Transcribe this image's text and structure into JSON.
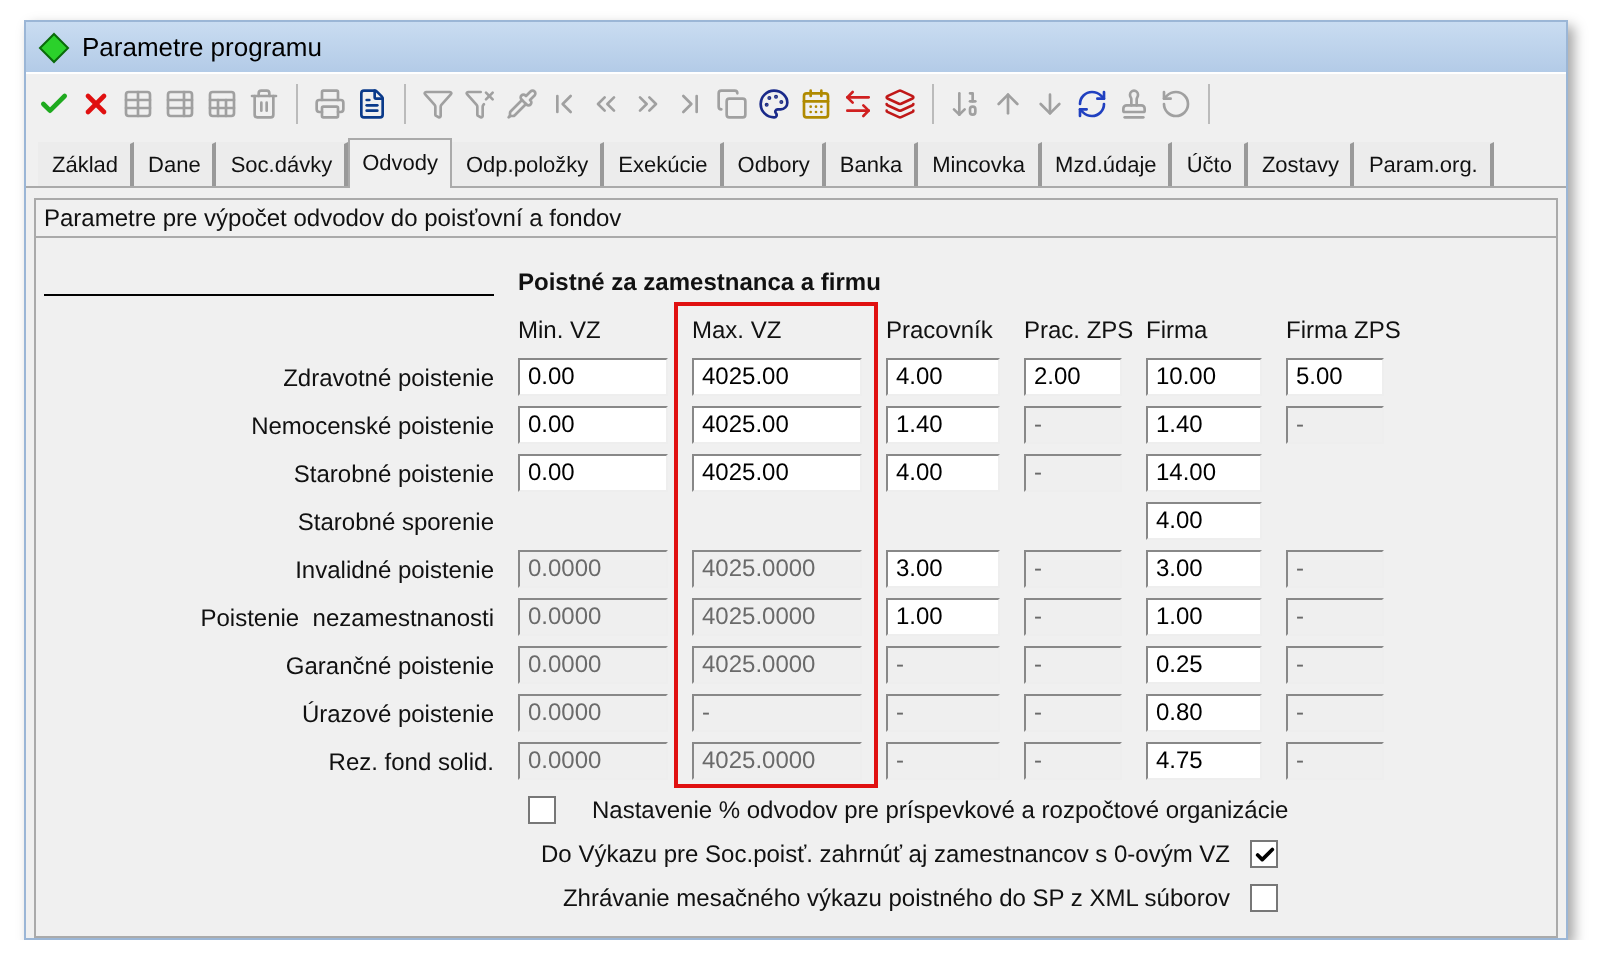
{
  "window": {
    "title": "Parametre programu"
  },
  "toolbar": [
    {
      "kind": "ok",
      "disabled": false
    },
    {
      "kind": "cancel",
      "disabled": false
    },
    {
      "kind": "table-add",
      "disabled": true
    },
    {
      "kind": "table-remove",
      "disabled": true
    },
    {
      "kind": "table-edit",
      "disabled": true
    },
    {
      "kind": "table-delete",
      "disabled": true
    },
    {
      "kind": "sep"
    },
    {
      "kind": "print",
      "disabled": true
    },
    {
      "kind": "preview",
      "disabled": false
    },
    {
      "kind": "sep"
    },
    {
      "kind": "filter",
      "disabled": true
    },
    {
      "kind": "filter-clear",
      "disabled": true
    },
    {
      "kind": "pick",
      "disabled": true
    },
    {
      "kind": "first",
      "disabled": true
    },
    {
      "kind": "prev",
      "disabled": true
    },
    {
      "kind": "next",
      "disabled": true
    },
    {
      "kind": "last",
      "disabled": true
    },
    {
      "kind": "copy",
      "disabled": true
    },
    {
      "kind": "palette",
      "disabled": false
    },
    {
      "kind": "calendar",
      "disabled": false
    },
    {
      "kind": "transfer",
      "disabled": false
    },
    {
      "kind": "windows",
      "disabled": false
    },
    {
      "kind": "sep"
    },
    {
      "kind": "sort",
      "disabled": true
    },
    {
      "kind": "up",
      "disabled": true
    },
    {
      "kind": "down",
      "disabled": true
    },
    {
      "kind": "refresh",
      "disabled": false
    },
    {
      "kind": "stamp",
      "disabled": true
    },
    {
      "kind": "undo",
      "disabled": true
    },
    {
      "kind": "sep"
    }
  ],
  "tabs": [
    {
      "label": "Základ",
      "selected": false
    },
    {
      "label": "Dane",
      "selected": false
    },
    {
      "label": "Soc.dávky",
      "selected": false
    },
    {
      "label": "Odvody",
      "selected": true
    },
    {
      "label": "Odp.položky",
      "selected": false
    },
    {
      "label": "Exekúcie",
      "selected": false
    },
    {
      "label": "Odbory",
      "selected": false
    },
    {
      "label": "Banka",
      "selected": false
    },
    {
      "label": "Mincovka",
      "selected": false
    },
    {
      "label": "Mzd.údaje",
      "selected": false
    },
    {
      "label": "Účto",
      "selected": false
    },
    {
      "label": "Zostavy",
      "selected": false
    },
    {
      "label": "Param.org.",
      "selected": false
    }
  ],
  "section_title": "Parametre pre výpočet odvodov do poisťovní a fondov",
  "group_title": "Poistné za zamestnanca a firmu",
  "columns": [
    {
      "label": "Min. VZ",
      "highlighted": false
    },
    {
      "label": "Max. VZ",
      "highlighted": true
    },
    {
      "label": "Pracovník",
      "highlighted": false
    },
    {
      "label": "Prac. ZPS",
      "highlighted": false
    },
    {
      "label": "Firma",
      "highlighted": false
    },
    {
      "label": "Firma ZPS",
      "highlighted": false
    }
  ],
  "rows": [
    {
      "label": "Zdravotné poistenie",
      "cells": [
        {
          "value": "0.00",
          "disabled": false
        },
        {
          "value": "4025.00",
          "disabled": false
        },
        {
          "value": "4.00",
          "disabled": false
        },
        {
          "value": "2.00",
          "disabled": false
        },
        {
          "value": "10.00",
          "disabled": false
        },
        {
          "value": "5.00",
          "disabled": false
        }
      ]
    },
    {
      "label": "Nemocenské poistenie",
      "cells": [
        {
          "value": "0.00",
          "disabled": false
        },
        {
          "value": "4025.00",
          "disabled": false
        },
        {
          "value": "1.40",
          "disabled": false
        },
        {
          "value": "-",
          "disabled": true
        },
        {
          "value": "1.40",
          "disabled": false
        },
        {
          "value": "-",
          "disabled": true
        }
      ]
    },
    {
      "label": "Starobné poistenie",
      "cells": [
        {
          "value": "0.00",
          "disabled": false
        },
        {
          "value": "4025.00",
          "disabled": false
        },
        {
          "value": "4.00",
          "disabled": false
        },
        {
          "value": "-",
          "disabled": true
        },
        {
          "value": "14.00",
          "disabled": false
        },
        null
      ]
    },
    {
      "label": "Starobné sporenie",
      "cells": [
        null,
        null,
        null,
        null,
        {
          "value": "4.00",
          "disabled": false
        },
        null
      ]
    },
    {
      "label": "Invalidné poistenie",
      "cells": [
        {
          "value": "0.0000",
          "disabled": true
        },
        {
          "value": "4025.0000",
          "disabled": true
        },
        {
          "value": "3.00",
          "disabled": false
        },
        {
          "value": "-",
          "disabled": true
        },
        {
          "value": "3.00",
          "disabled": false
        },
        {
          "value": "-",
          "disabled": true
        }
      ]
    },
    {
      "label": "Poistenie  nezamestnanosti",
      "cells": [
        {
          "value": "0.0000",
          "disabled": true
        },
        {
          "value": "4025.0000",
          "disabled": true
        },
        {
          "value": "1.00",
          "disabled": false
        },
        {
          "value": "-",
          "disabled": true
        },
        {
          "value": "1.00",
          "disabled": false
        },
        {
          "value": "-",
          "disabled": true
        }
      ]
    },
    {
      "label": "Garančné poistenie",
      "cells": [
        {
          "value": "0.0000",
          "disabled": true
        },
        {
          "value": "4025.0000",
          "disabled": true
        },
        {
          "value": "-",
          "disabled": true
        },
        {
          "value": "-",
          "disabled": true
        },
        {
          "value": "0.25",
          "disabled": false
        },
        {
          "value": "-",
          "disabled": true
        }
      ]
    },
    {
      "label": "Úrazové poistenie",
      "cells": [
        {
          "value": "0.0000",
          "disabled": true
        },
        {
          "value": "-",
          "disabled": true
        },
        {
          "value": "-",
          "disabled": true
        },
        {
          "value": "-",
          "disabled": true
        },
        {
          "value": "0.80",
          "disabled": false
        },
        {
          "value": "-",
          "disabled": true
        }
      ]
    },
    {
      "label": "Rez. fond solid.",
      "cells": [
        {
          "value": "0.0000",
          "disabled": true
        },
        {
          "value": "4025.0000",
          "disabled": true
        },
        {
          "value": "-",
          "disabled": true
        },
        {
          "value": "-",
          "disabled": true
        },
        {
          "value": "4.75",
          "disabled": false
        },
        {
          "value": "-",
          "disabled": true
        }
      ]
    }
  ],
  "options": [
    {
      "kind": "leading",
      "label": "Nastavenie % odvodov pre príspevkové a rozpočtové organizácie",
      "checked": false
    },
    {
      "kind": "trailing",
      "label": "Do Výkazu pre Soc.poisť. zahrnúť aj zamestnancov s 0-ovým VZ",
      "checked": true
    },
    {
      "kind": "trailing",
      "label": "Zhrávanie mesačného výkazu poistného do SP z XML súborov",
      "checked": false
    }
  ]
}
